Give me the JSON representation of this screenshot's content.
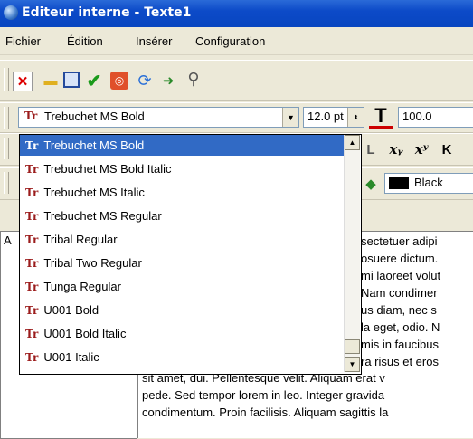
{
  "window": {
    "title": "Editeur interne - Texte1"
  },
  "menu": [
    "Fichier",
    "Édition",
    "Insérer",
    "Configuration"
  ],
  "toolbar": {
    "icons": [
      "delete-doc-icon",
      "open-folder-icon",
      "save-disk-icon",
      "check-icon",
      "stop-icon",
      "refresh-icon",
      "export-icon",
      "search-tools-icon"
    ]
  },
  "format_toolbar": {
    "font_value": "Trebuchet MS Bold",
    "size_value": "12.0 pt",
    "zoom_value": "100.0"
  },
  "font_dropdown": {
    "items": [
      "Trebuchet MS Bold",
      "Trebuchet MS Bold Italic",
      "Trebuchet MS Italic",
      "Trebuchet MS Regular",
      "Tribal Regular",
      "Tribal Two Regular",
      "Tunga Regular",
      "U001 Bold",
      "U001 Bold Italic",
      "U001 Italic"
    ],
    "selected_index": 0,
    "icon_glyph": "Tr"
  },
  "color_toolbar": {
    "color_label": "Black",
    "color_swatch": "#000000"
  },
  "left_panel": {
    "label": "A"
  },
  "editor": {
    "lines_right": [
      "sectetuer adipi",
      "osuere dictum.",
      "mi laoreet volut",
      "Nam condimer",
      "us diam, nec s",
      "la eget, odio. N",
      "mis in faucibus",
      "ra risus et eros"
    ],
    "lines_full": [
      "sit amet, dui. Pellentesque velit. Aliquam erat v",
      "pede. Sed tempor lorem in leo. Integer gravida",
      "condimentum. Proin facilisis. Aliquam sagittis la"
    ]
  },
  "colors": {
    "title_bar": "#0c4ac8",
    "selection": "#316ac5",
    "accent_red": "#9b1c1c"
  }
}
